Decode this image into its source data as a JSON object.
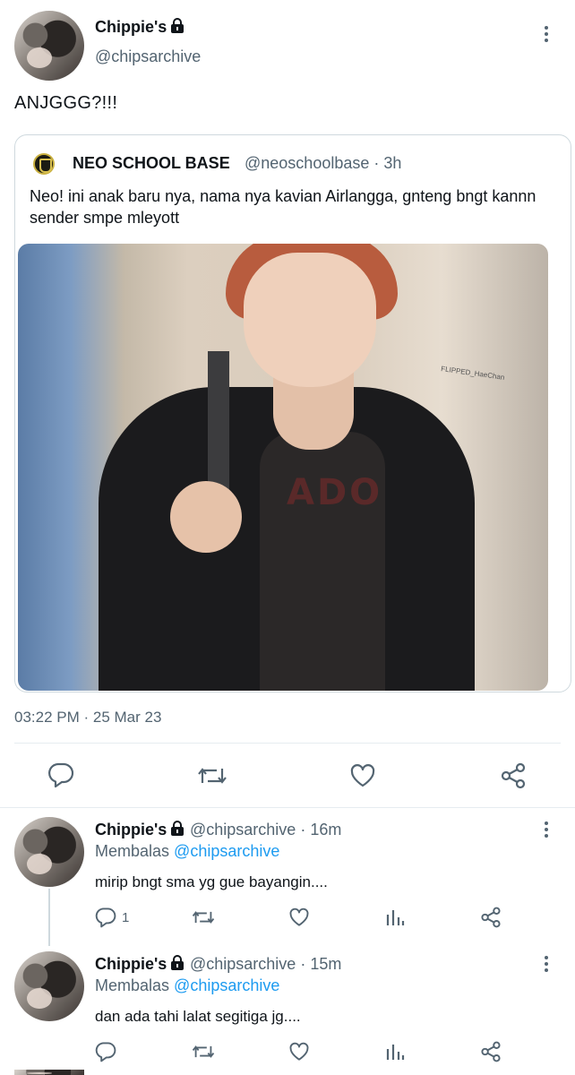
{
  "tweet": {
    "author_name": "Chippie's",
    "author_handle": "@chipsarchive",
    "text": "ANJGGG?!!!",
    "timestamp": "03:22 PM · 25 Mar 23"
  },
  "quoted": {
    "name": "NEO SCHOOL BASE",
    "handle_time": "@neoschoolbase · 3h",
    "text": "Neo! ini anak baru nya, nama nya kavian Airlangga, gnteng bngt kannn sender smpe mleyott",
    "photo_watermark": "FLIPPED_HaeChan",
    "photo_shirt_print": "ADO"
  },
  "replies": [
    {
      "name": "Chippie's",
      "handle_time": "@chipsarchive · 16m",
      "replying_prefix": "Membalas",
      "replying_to": "@chipsarchive",
      "text": "mirip bngt sma yg gue bayangin....",
      "reply_count": "1"
    },
    {
      "name": "Chippie's",
      "handle_time": "@chipsarchive · 15m",
      "replying_prefix": "Membalas",
      "replying_to": "@chipsarchive",
      "text": "dan ada tahi lalat segitiga jg....",
      "reply_count": ""
    }
  ],
  "icons": {
    "reply": "reply-icon",
    "retweet": "retweet-icon",
    "like": "heart-icon",
    "share": "share-icon",
    "views": "analytics-icon",
    "more": "more-options-icon",
    "lock": "lock-icon"
  },
  "colors": {
    "link": "#1d9bf0",
    "secondary_text": "#536471",
    "primary_text": "#0f1419"
  }
}
